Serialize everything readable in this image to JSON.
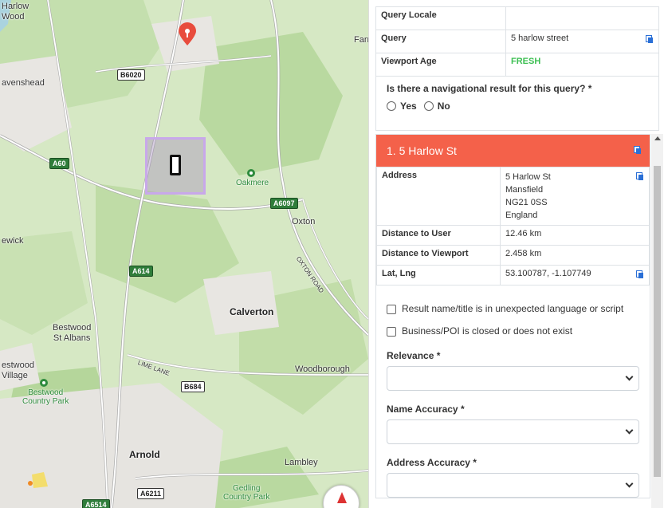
{
  "map": {
    "places": {
      "harlow_wood": "Harlow\nWood",
      "farnsfield": "Farr",
      "ravenshead": "avenshead",
      "oakmere": "Oakmere",
      "oxton": "Oxton",
      "newick": "ewick",
      "calverton": "Calverton",
      "bestwood_st_albans": "Bestwood\nSt Albans",
      "bestwood_village": "estwood\nVillage",
      "bestwood_country_park": "Bestwood\nCountry Park",
      "woodborough": "Woodborough",
      "arnold": "Arnold",
      "lambley": "Lambley",
      "gedling_country_park": "Gedling\nCountry Park",
      "lime_lane": "LIME LANE",
      "oxton_road": "OXTON ROAD"
    },
    "roads": {
      "b6020": "B6020",
      "a60": "A60",
      "a6097": "A6097",
      "a614": "A614",
      "b684": "B684",
      "a6211": "A6211",
      "a6514": "A6514"
    },
    "icons": {
      "pin": "map-pin-icon",
      "device": "device-icon",
      "compass": "compass-icon"
    }
  },
  "meta": {
    "query_locale_label": "Query Locale",
    "query_locale_value": "",
    "query_label": "Query",
    "query_value": "5 harlow street",
    "viewport_age_label": "Viewport Age",
    "viewport_age_value": "FRESH"
  },
  "nav_question": {
    "label": "Is there a navigational result for this query? *",
    "yes": "Yes",
    "no": "No"
  },
  "result": {
    "title": "1. 5 Harlow St",
    "address_label": "Address",
    "address_lines": [
      "5 Harlow St",
      "Mansfield",
      "NG21 0SS",
      "England"
    ],
    "distance_user_label": "Distance to User",
    "distance_user_value": "12.46 km",
    "distance_viewport_label": "Distance to Viewport",
    "distance_viewport_value": "2.458 km",
    "latlng_label": "Lat, Lng",
    "latlng_value": "53.100787, -1.107749",
    "check_language": "Result name/title is in unexpected language or script",
    "check_closed": "Business/POI is closed or does not exist",
    "relevance_label": "Relevance *",
    "name_accuracy_label": "Name Accuracy *",
    "address_accuracy_label": "Address Accuracy *"
  },
  "colors": {
    "result_header": "#f4614a",
    "fresh": "#3cbf52",
    "map_bg": "#d6e8c4",
    "viewport_border": "#c8a8ea",
    "pin": "#e84c3d"
  }
}
